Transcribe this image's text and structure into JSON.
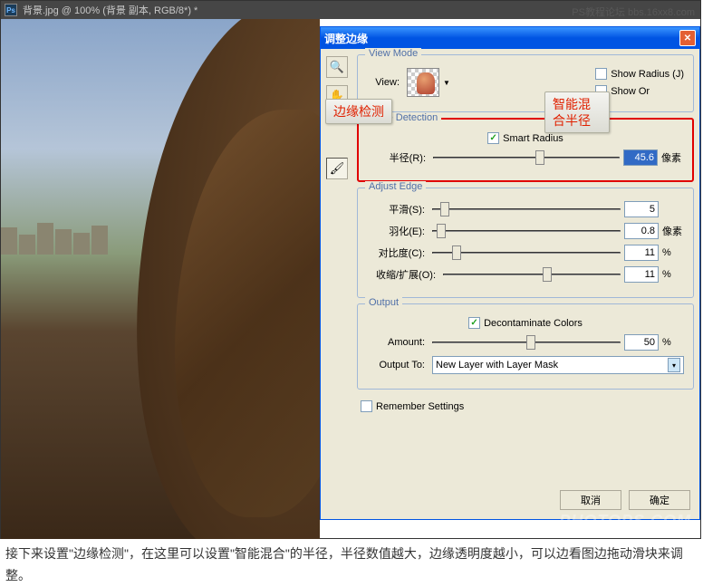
{
  "topbar": {
    "ps_icon": "Ps",
    "document_title": "背景.jpg @ 100% (背景 副本, RGB/8*) *"
  },
  "dialog": {
    "title": "调整边缘",
    "view_mode": {
      "legend": "View Mode",
      "view_label": "View:",
      "show_radius": "Show Radius (J)",
      "show_original_truncated": "Show Or"
    },
    "edge_detection": {
      "legend": "Edge Detection",
      "smart_radius": "Smart Radius",
      "radius_label": "半径(R):",
      "radius_value": "45.6",
      "radius_unit": "像素"
    },
    "adjust_edge": {
      "legend": "Adjust Edge",
      "smooth_label": "平滑(S):",
      "smooth_value": "5",
      "feather_label": "羽化(E):",
      "feather_value": "0.8",
      "feather_unit": "像素",
      "contrast_label": "对比度(C):",
      "contrast_value": "11",
      "contrast_unit": "%",
      "shift_label": "收缩/扩展(O):",
      "shift_value": "11",
      "shift_unit": "%"
    },
    "output": {
      "legend": "Output",
      "decontaminate": "Decontaminate Colors",
      "amount_label": "Amount:",
      "amount_value": "50",
      "amount_unit": "%",
      "output_to_label": "Output To:",
      "output_to_value": "New Layer with Layer Mask"
    },
    "remember": "Remember Settings",
    "cancel": "取消",
    "ok": "确定"
  },
  "annotations": {
    "edge_detect": "边缘检测",
    "smart_mix": "智能混合半径"
  },
  "caption": "接下来设置\"边缘检测\"，在这里可以设置\"智能混合\"的半径，半径数值越大，边缘透明度越小，可以边看图边拖动滑块来调整。",
  "watermarks": {
    "top": "PS教程论坛\nbbs.16xx8.com",
    "bottom": "PHOTOPS.COM"
  }
}
